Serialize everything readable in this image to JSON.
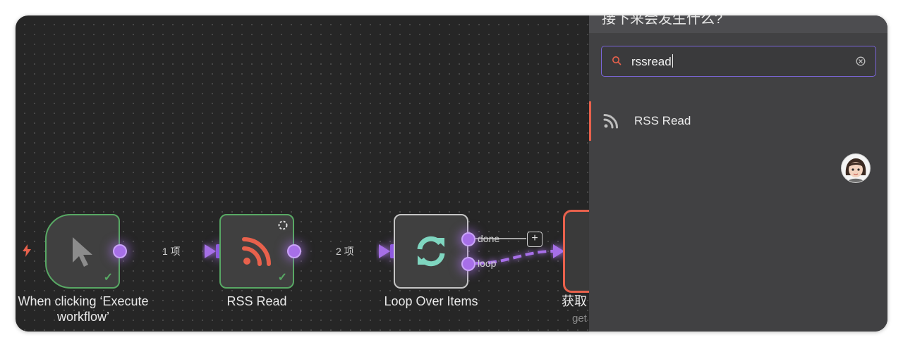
{
  "canvas": {
    "nodes": [
      {
        "label": "When clicking ‘Execute workflow’",
        "status": "success",
        "icon": "cursor-icon"
      },
      {
        "label": "RSS Read",
        "status": "success",
        "icon": "rss-icon"
      },
      {
        "label": "Loop Over Items",
        "icon": "loop-icon"
      },
      {
        "label": "获取",
        "sublabel": "get",
        "status": "error"
      }
    ],
    "edges": {
      "e1_label": "1 项",
      "e2_label": "2 项",
      "done_label": "done",
      "loop_label": "loop"
    },
    "colors": {
      "accent": "#a76fe8",
      "success": "#58a864",
      "error": "#e8614c",
      "rss": "#e8614c",
      "loop": "#7fd6c0"
    }
  },
  "panel": {
    "title": "接下来会发生什么?",
    "search": {
      "value": "rssread"
    },
    "results": [
      {
        "label": "RSS Read",
        "icon": "rss-icon"
      }
    ]
  }
}
